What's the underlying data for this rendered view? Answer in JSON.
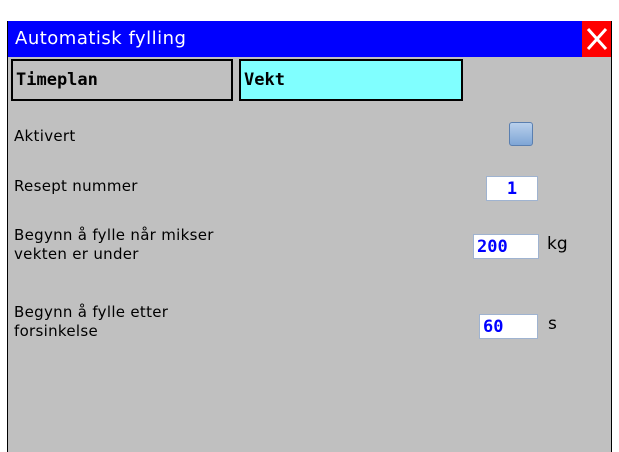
{
  "window": {
    "title": "Automatisk fylling"
  },
  "tabs": [
    {
      "label": "Timeplan"
    },
    {
      "label": "Vekt"
    }
  ],
  "fields": {
    "aktivert": {
      "label": "Aktivert",
      "checked": false
    },
    "resept": {
      "label": "Resept nummer",
      "value": "1"
    },
    "vekt": {
      "label_line1": "Begynn å fylle når mikser",
      "label_line2": "vekten er under",
      "value": "200",
      "unit": "kg"
    },
    "forsinkelse": {
      "label_line1": "Begynn å fylle etter",
      "label_line2": "forsinkelse",
      "value": "60",
      "unit": "s"
    }
  },
  "colors": {
    "titlebar": "#0000ff",
    "active_tab": "#80ffff",
    "value_text": "#0000ff",
    "close": "#ff0000"
  }
}
